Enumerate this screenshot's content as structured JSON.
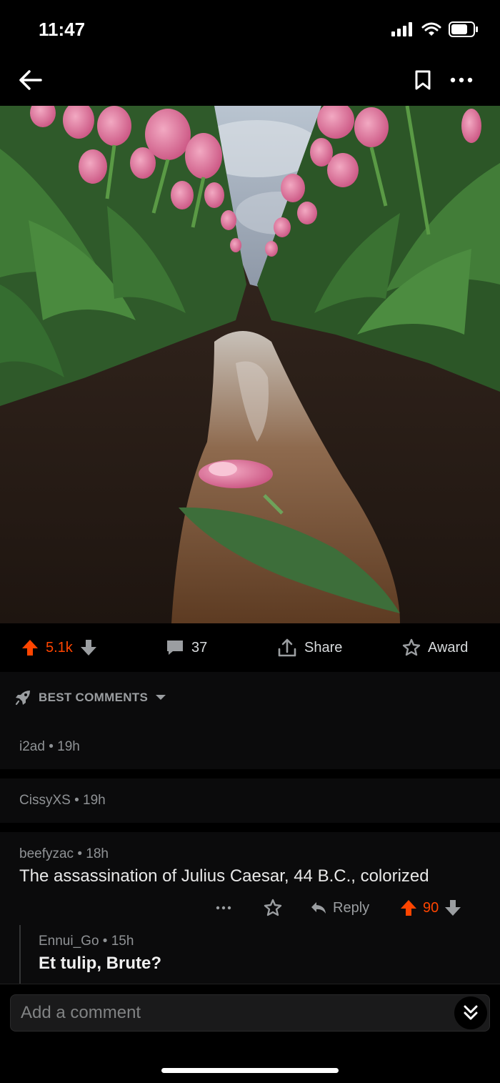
{
  "status_bar": {
    "time": "11:47"
  },
  "post": {
    "image_alt": "pink tulip lying in a muddy puddle between rows of tulips",
    "upvotes": "5.1k",
    "comments_count": "37",
    "share_label": "Share",
    "award_label": "Award"
  },
  "sort": {
    "label": "BEST COMMENTS"
  },
  "comments": [
    {
      "author": "i2ad",
      "age": "19h"
    },
    {
      "author": "CissyXS",
      "age": "19h"
    },
    {
      "author": "beefyzac",
      "age": "18h",
      "body": "The assassination of Julius Caesar, 44 B.C., colorized",
      "reply_label": "Reply",
      "score": "90",
      "replies": [
        {
          "author": "Ennui_Go",
          "age": "15h",
          "body": "Et tulip, Brute?"
        }
      ]
    }
  ],
  "composer": {
    "placeholder": "Add a comment"
  },
  "colors": {
    "accent": "#ff4500",
    "background": "#000000",
    "surface": "#0b0b0c"
  },
  "icons": [
    "back-arrow-icon",
    "bookmark-icon",
    "more-icon",
    "upvote-icon",
    "downvote-icon",
    "comment-icon",
    "share-icon",
    "award-icon",
    "rocket-icon",
    "chevron-down-icon",
    "reply-icon",
    "double-chevron-down-icon"
  ]
}
